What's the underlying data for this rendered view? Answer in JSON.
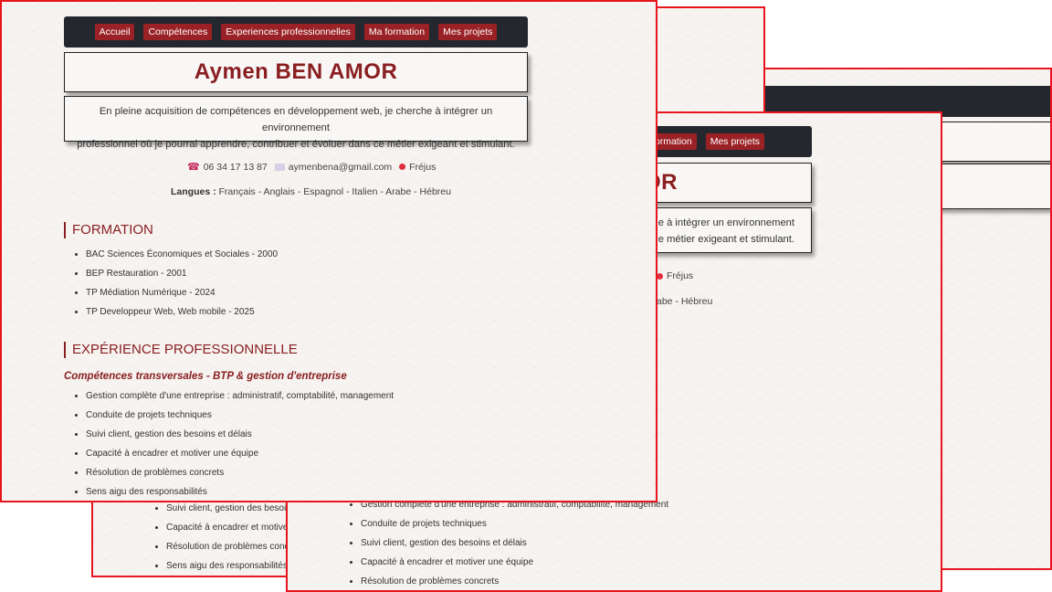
{
  "nav": {
    "accueil": "Accueil",
    "competences": "Compétences",
    "experiences": "Experiences professionnelles",
    "formation": "Ma formation",
    "projets": "Mes projets",
    "menu_fragment": "lles",
    "formation_fragment": "formation"
  },
  "name": "Aymen BEN AMOR",
  "name_fragment": "OR",
  "intro": {
    "line1": "En pleine acquisition de compétences en développement web, je cherche à intégrer un environnement",
    "line2": "professionnel où je pourrai apprendre, contribuer et évoluer dans ce métier exigeant et stimulant.",
    "line1_fragment": "che à intégrer un environnement",
    "line2_fragment": "e métier exigeant et stimulant.",
    "fragment_t": "t"
  },
  "contact": {
    "phone": "06 34 17 13 87",
    "email": "aymenbena@gmail.com",
    "city": "Fréjus",
    "phone_icon": "phone-icon",
    "email_icon": "mail-icon",
    "city_icon": "pin-icon"
  },
  "languages": {
    "label": "Langues :",
    "list": "Français - Anglais - Espagnol - Italien - Arabe - Hébreu",
    "fragment": "abe - Hébreu"
  },
  "formation": {
    "title": "FORMATION",
    "items": [
      "BAC Sciences Économiques et Sociales - 2000",
      "BEP Restauration - 2001",
      "TP Médiation Numérique - 2024",
      "TP Developpeur Web, Web mobile - 2025"
    ]
  },
  "experience": {
    "title": "EXPÉRIENCE PROFESSIONNELLE",
    "subtitle": "Compétences transversales - BTP & gestion d'entreprise",
    "items": [
      "Gestion complète d'une entreprise : administratif, comptabilité, management",
      "Conduite de projets techniques",
      "Suivi client, gestion des besoins et délais",
      "Capacité à encadrer et motiver une équipe",
      "Résolution de problèmes concrets",
      "Sens aigu des responsabilités"
    ],
    "frag_suivi": "Suivi client, gestion des besoins",
    "frag_capacite": "Capacité à encadrer et motiver u",
    "frag_resolution": "Résolution de problèmes concre"
  },
  "colors": {
    "accent": "#8a1f22",
    "button": "#9a2125",
    "navbar": "#24272d",
    "frame_border": "#e8141e",
    "background": "#f6f3f0"
  }
}
